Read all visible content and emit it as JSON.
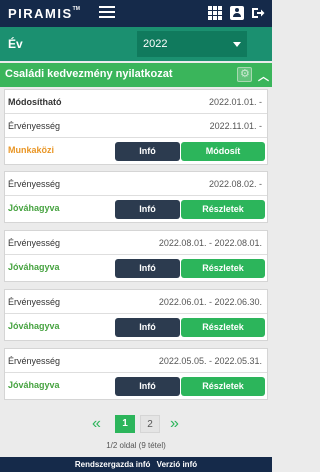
{
  "header": {
    "logo": "PIRAMIS",
    "logo_tm": "TM"
  },
  "year": {
    "label": "Év",
    "selected": "2022"
  },
  "section": {
    "title": "Családi kedvezmény nyilatkozat"
  },
  "cards": [
    {
      "row1_label": "Módosítható",
      "row1_value": "2022.01.01. -",
      "row2_label": "Érvényesség",
      "row2_value": "2022.11.01. -",
      "status": "Munkaközi",
      "btn1": "Infó",
      "btn2": "Módosít"
    },
    {
      "row1_label": "Érvényesség",
      "row1_value": "2022.08.02. -",
      "status": "Jóváhagyva",
      "btn1": "Infó",
      "btn2": "Részletek"
    },
    {
      "row1_label": "Érvényesség",
      "row1_value": "2022.08.01. - 2022.08.01.",
      "status": "Jóváhagyva",
      "btn1": "Infó",
      "btn2": "Részletek"
    },
    {
      "row1_label": "Érvényesség",
      "row1_value": "2022.06.01. - 2022.06.30.",
      "status": "Jóváhagyva",
      "btn1": "Infó",
      "btn2": "Részletek"
    },
    {
      "row1_label": "Érvényesség",
      "row1_value": "2022.05.05. - 2022.05.31.",
      "status": "Jóváhagyva",
      "btn1": "Infó",
      "btn2": "Részletek"
    }
  ],
  "pagination": {
    "prev": "«",
    "next": "»",
    "page1": "1",
    "page2": "2",
    "info": "1/2 oldal (9 tétel)"
  },
  "footer": {
    "admin": "Rendszergazda infó",
    "version": "Verzió infó"
  },
  "colors": {
    "navy": "#152a4a",
    "teal": "#1b9070",
    "green": "#2cb55b",
    "dark_button": "#2c3b4f",
    "orange_status": "#e99626"
  },
  "icons": [
    "menu-icon",
    "apps-grid-icon",
    "user-card-icon",
    "logout-icon",
    "gear-icon",
    "chevron-up-icon"
  ]
}
